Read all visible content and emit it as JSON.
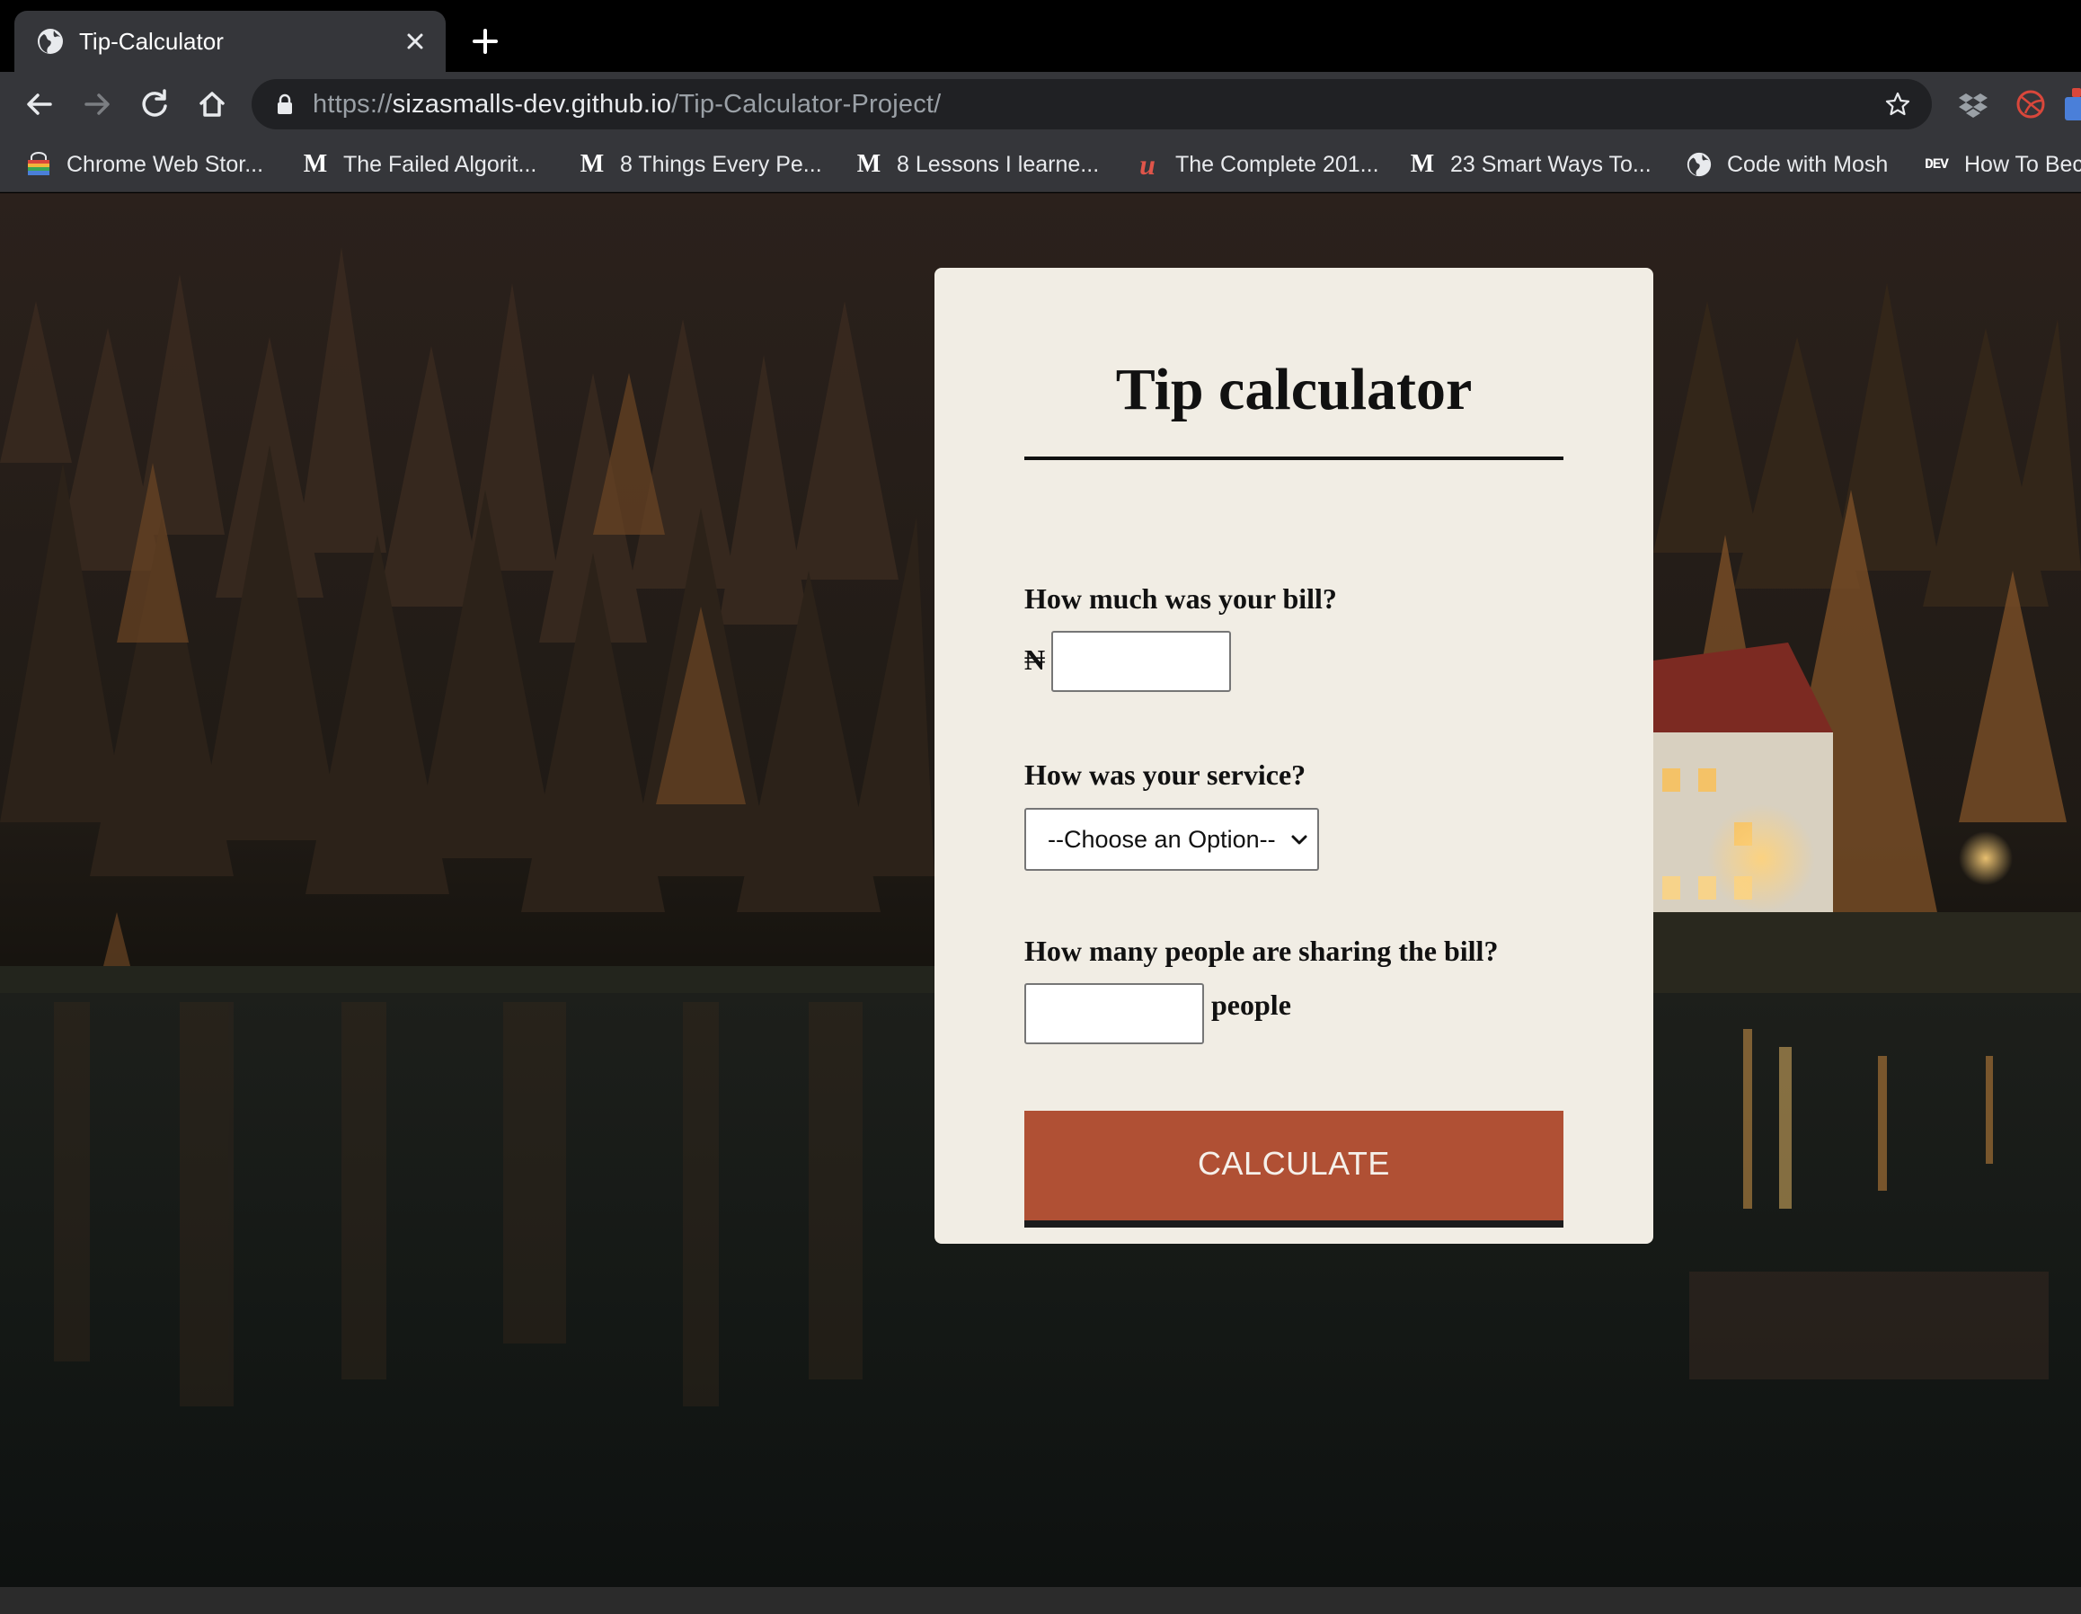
{
  "browser": {
    "tab_title": "Tip-Calculator",
    "url_scheme": "https://",
    "url_host": "sizasmalls-dev.github.io",
    "url_path": "/Tip-Calculator-Project/",
    "bookmarks": [
      {
        "label": "Chrome Web Stor...",
        "icon": "chrome-web-store-icon"
      },
      {
        "label": "The Failed Algorit...",
        "icon": "medium-icon"
      },
      {
        "label": "8 Things Every Pe...",
        "icon": "medium-icon"
      },
      {
        "label": "8 Lessons I learne...",
        "icon": "medium-icon"
      },
      {
        "label": "The Complete 201...",
        "icon": "udemy-icon"
      },
      {
        "label": "23 Smart Ways To...",
        "icon": "medium-icon"
      },
      {
        "label": "Code with Mosh",
        "icon": "globe-icon"
      },
      {
        "label": "How To Bec",
        "icon": "dev-icon"
      }
    ],
    "medium_logo": "M",
    "udemy_logo": "u",
    "dev_logo": "DEV"
  },
  "page": {
    "title": "Tip calculator",
    "bill_question": "How much was your bill?",
    "currency_symbol": "₦",
    "bill_value": "",
    "service_question": "How was your service?",
    "service_selected": "--Choose an Option--",
    "people_question": "How many people are sharing the bill?",
    "people_value": "",
    "people_suffix": "people",
    "calculate_label": "CALCULATE"
  },
  "colors": {
    "card_bg": "#f1ede4",
    "button_bg": "#b05034",
    "button_border": "#1c1c1c"
  }
}
